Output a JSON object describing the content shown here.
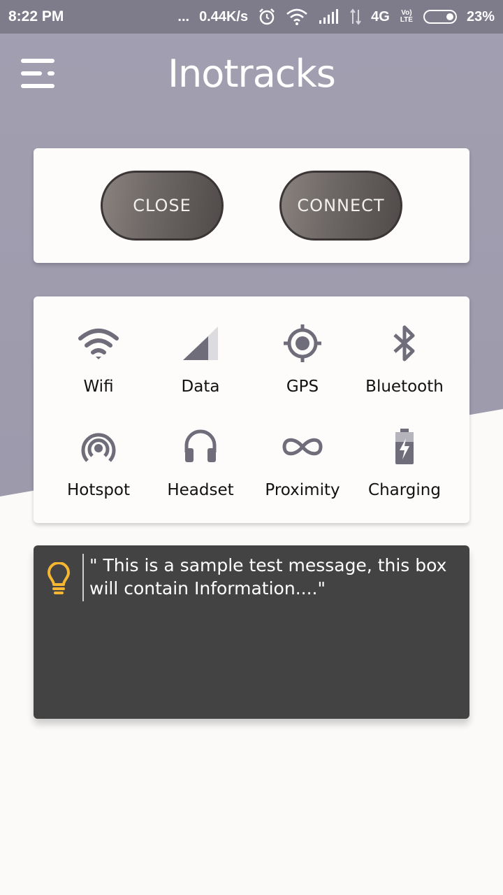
{
  "status_bar": {
    "time": "8:22 PM",
    "dots": "...",
    "speed": "0.44K/s",
    "network": "4G",
    "volte": "Vo)\nLTE",
    "battery": "23%",
    "icons": [
      "alarm-icon",
      "wifi-icon",
      "signal-icon",
      "data-arrows-icon",
      "volte-icon",
      "battery-icon"
    ]
  },
  "header": {
    "title": "Inotracks",
    "menu_icon": "hamburger-menu-icon"
  },
  "actions": {
    "close_label": "CLOSE",
    "connect_label": "CONNECT"
  },
  "sensors": [
    {
      "label": "Wifi",
      "icon": "wifi-icon"
    },
    {
      "label": "Data",
      "icon": "cellular-data-icon"
    },
    {
      "label": "GPS",
      "icon": "gps-icon"
    },
    {
      "label": "Bluetooth",
      "icon": "bluetooth-icon"
    },
    {
      "label": "Hotspot",
      "icon": "hotspot-icon"
    },
    {
      "label": "Headset",
      "icon": "headset-icon"
    },
    {
      "label": "Proximity",
      "icon": "proximity-icon"
    },
    {
      "label": "Charging",
      "icon": "charging-icon"
    }
  ],
  "info": {
    "message": "\" This is a sample test message, this box will contain Information....\"",
    "icon": "lightbulb-icon",
    "icon_color": "#f5b731"
  },
  "colors": {
    "header_bg": "#a19fb0",
    "status_bar_bg": "#7e7c8a",
    "icon_grey": "#6f6d7a",
    "info_bg": "#434343"
  }
}
